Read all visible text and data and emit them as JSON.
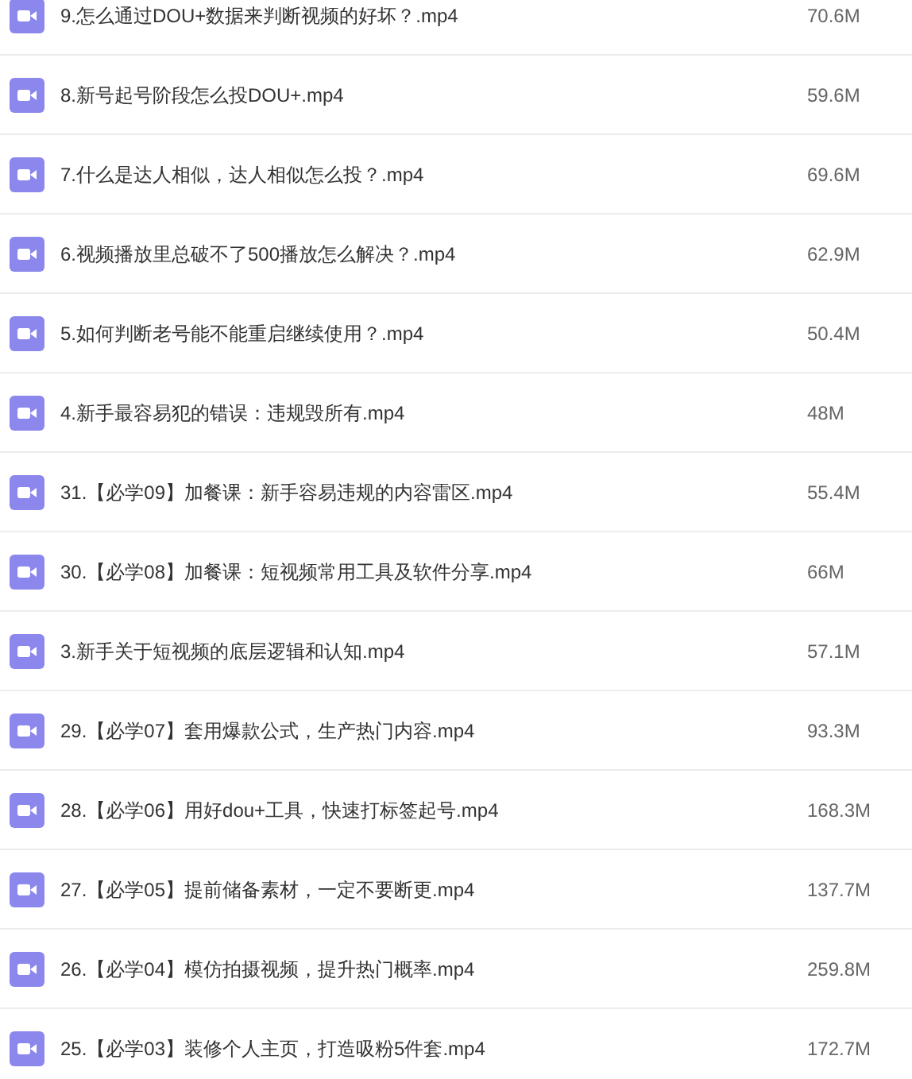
{
  "files": [
    {
      "name": "9.怎么通过DOU+数据来判断视频的好坏？.mp4",
      "size": "70.6M"
    },
    {
      "name": "8.新号起号阶段怎么投DOU+.mp4",
      "size": "59.6M"
    },
    {
      "name": "7.什么是达人相似，达人相似怎么投？.mp4",
      "size": "69.6M"
    },
    {
      "name": "6.视频播放里总破不了500播放怎么解决？.mp4",
      "size": "62.9M"
    },
    {
      "name": "5.如何判断老号能不能重启继续使用？.mp4",
      "size": "50.4M"
    },
    {
      "name": "4.新手最容易犯的错误：违规毁所有.mp4",
      "size": "48M"
    },
    {
      "name": "31.【必学09】加餐课：新手容易违规的内容雷区.mp4",
      "size": "55.4M"
    },
    {
      "name": "30.【必学08】加餐课：短视频常用工具及软件分享.mp4",
      "size": "66M"
    },
    {
      "name": "3.新手关于短视频的底层逻辑和认知.mp4",
      "size": "57.1M"
    },
    {
      "name": "29.【必学07】套用爆款公式，生产热门内容.mp4",
      "size": "93.3M"
    },
    {
      "name": "28.【必学06】用好dou+工具，快速打标签起号.mp4",
      "size": "168.3M"
    },
    {
      "name": "27.【必学05】提前储备素材，一定不要断更.mp4",
      "size": "137.7M"
    },
    {
      "name": "26.【必学04】模仿拍摄视频，提升热门概率.mp4",
      "size": "259.8M"
    },
    {
      "name": "25.【必学03】装修个人主页，打造吸粉5件套.mp4",
      "size": "172.7M"
    }
  ]
}
